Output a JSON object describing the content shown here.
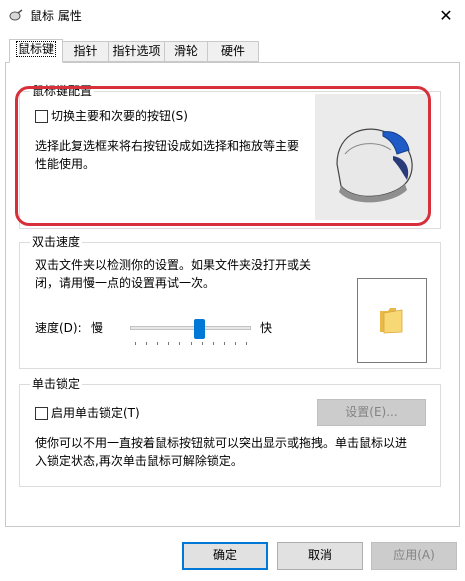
{
  "window": {
    "title": "鼠标 属性",
    "close_glyph": "✕"
  },
  "tabs": [
    {
      "label": "鼠标键",
      "active": true
    },
    {
      "label": "指针",
      "active": false
    },
    {
      "label": "指针选项",
      "active": false
    },
    {
      "label": "滑轮",
      "active": false
    },
    {
      "label": "硬件",
      "active": false
    }
  ],
  "button_config": {
    "title": "鼠标键配置",
    "checkbox_label": "切换主要和次要的按钮(S)",
    "checked": false,
    "description_line1": "选择此复选框来将右按钮设成如选择和拖放等主要",
    "description_line2": "性能使用。",
    "image_icon": "mouse-icon"
  },
  "double_click": {
    "title": "双击速度",
    "description_line1": "双击文件夹以检测你的设置。如果文件夹没打开或关",
    "description_line2": "闭，请用慢一点的设置再试一次。",
    "speed_label": "速度(D):",
    "slow_label": "慢",
    "fast_label": "快",
    "speed_value_fraction": 0.58,
    "folder_icon": "folder-icon"
  },
  "click_lock": {
    "title": "单击锁定",
    "checkbox_label": "启用单击锁定(T)",
    "checked": false,
    "settings_button": "设置(E)...",
    "settings_enabled": false,
    "description_line1": "使你可以不用一直按着鼠标按钮就可以突出显示或拖拽。单击鼠标以进",
    "description_line2": "入锁定状态,再次单击鼠标可解除锁定。"
  },
  "footer": {
    "ok": "确定",
    "cancel": "取消",
    "apply": "应用(A)"
  },
  "colors": {
    "highlight": "#d7303a",
    "accent": "#0078d7"
  }
}
